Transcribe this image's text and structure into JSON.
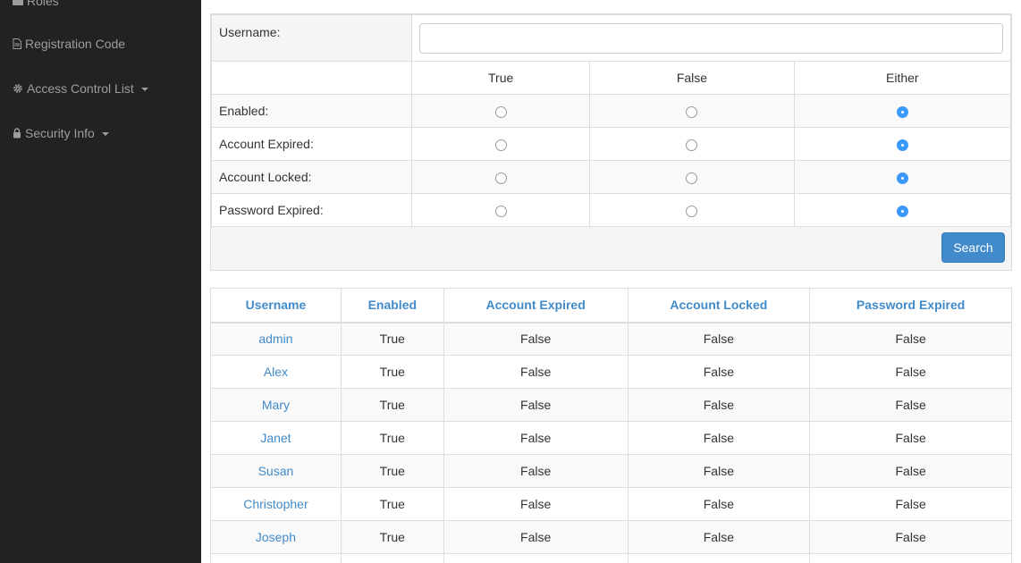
{
  "sidebar": {
    "items": [
      {
        "label": "Roles",
        "icon": "briefcase-icon"
      },
      {
        "label": "Registration Code",
        "icon": "file-icon"
      },
      {
        "label": "Access Control List",
        "icon": "gear-icon"
      },
      {
        "label": "Security Info",
        "icon": "lock-icon"
      }
    ]
  },
  "search_form": {
    "username_label": "Username:",
    "username_value": "",
    "columns": [
      "True",
      "False",
      "Either"
    ],
    "options": [
      {
        "label": "Enabled:",
        "selected": "Either"
      },
      {
        "label": "Account Expired:",
        "selected": "Either"
      },
      {
        "label": "Account Locked:",
        "selected": "Either"
      },
      {
        "label": "Password Expired:",
        "selected": "Either"
      }
    ],
    "search_label": "Search"
  },
  "results": {
    "headers": [
      "Username",
      "Enabled",
      "Account Expired",
      "Account Locked",
      "Password Expired"
    ],
    "rows": [
      [
        "admin",
        "True",
        "False",
        "False",
        "False"
      ],
      [
        "Alex",
        "True",
        "False",
        "False",
        "False"
      ],
      [
        "Mary",
        "True",
        "False",
        "False",
        "False"
      ],
      [
        "Janet",
        "True",
        "False",
        "False",
        "False"
      ],
      [
        "Susan",
        "True",
        "False",
        "False",
        "False"
      ],
      [
        "Christopher",
        "True",
        "False",
        "False",
        "False"
      ],
      [
        "Joseph",
        "True",
        "False",
        "False",
        "False"
      ]
    ]
  },
  "colors": {
    "sidebar_bg": "#222222",
    "sidebar_text": "#9d9d9d",
    "link": "#428bca",
    "radio_checked": "#3b99fc",
    "button": "#428bca"
  }
}
